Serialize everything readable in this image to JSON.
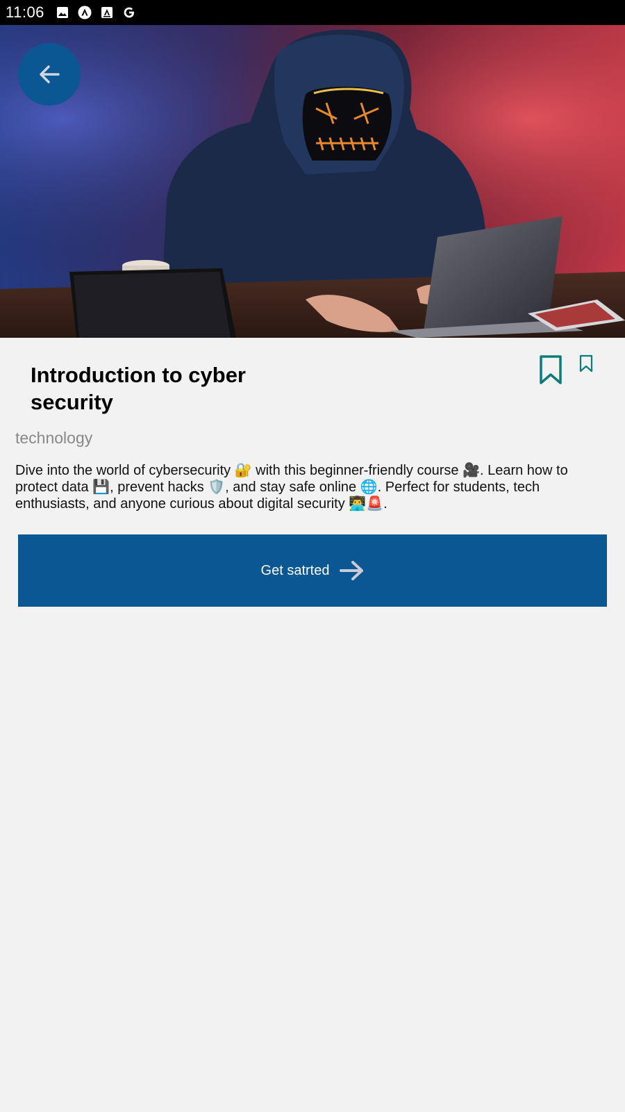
{
  "status_bar": {
    "time": "11:06",
    "icons": [
      "image-icon",
      "app-a-icon",
      "font-a-icon",
      "google-icon"
    ]
  },
  "hero": {
    "image": "hooded-hacker-laptop-photo"
  },
  "header": {
    "back_icon": "arrow-left-icon"
  },
  "course": {
    "title": "Introduction to cyber security",
    "category": "technology",
    "description": "Dive into the world of cybersecurity 🔐 with this beginner-friendly course 🎥. Learn how to protect data 💾, prevent hacks 🛡️, and stay safe online 🌐. Perfect for students, tech enthusiasts, and anyone curious about digital security 👨‍💻🚨."
  },
  "actions": {
    "bookmark_icons": [
      "bookmark-outline-icon",
      "bookmark-small-icon"
    ],
    "get_started_label": "Get satrted",
    "get_started_icon": "arrow-right-icon"
  },
  "colors": {
    "primary": "#0b5793",
    "bookmark": "#0a7d7a",
    "background": "#f2f2f2",
    "category_text": "#888888"
  }
}
